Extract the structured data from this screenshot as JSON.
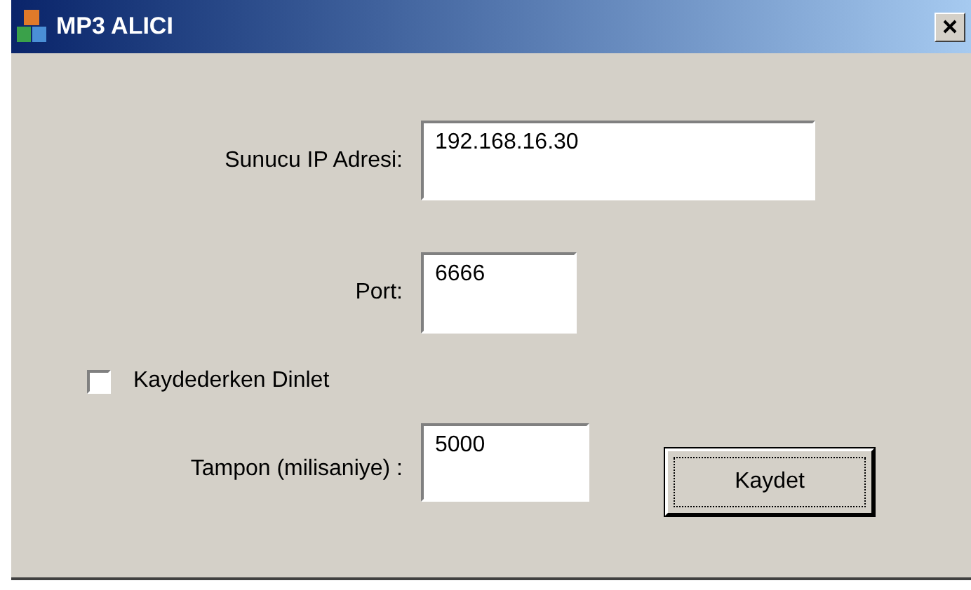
{
  "window": {
    "title": "MP3 ALICI"
  },
  "fields": [
    {
      "label": "Sunucu IP Adresi:",
      "value": "192.168.16.30"
    },
    {
      "label": "Port:",
      "value": "6666"
    }
  ],
  "checkbox": {
    "label": "Kaydederken Dinlet",
    "checked": false
  },
  "buffer": {
    "label": "Tampon (milisaniye) :",
    "value": "5000"
  },
  "button": {
    "label": "Kaydet"
  }
}
